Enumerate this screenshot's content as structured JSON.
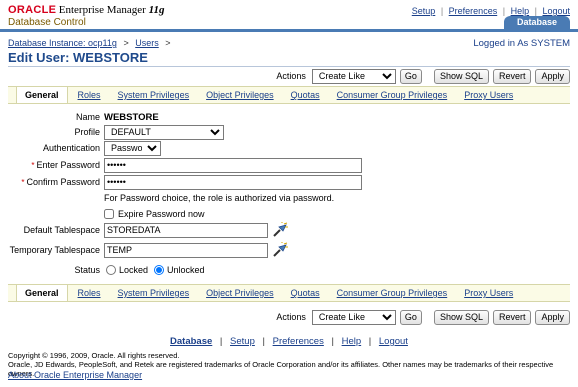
{
  "header": {
    "oracle": "ORACLE",
    "product": "Enterprise Manager",
    "version": "11",
    "version_suffix": "g",
    "subtitle": "Database Control",
    "global_links": [
      "Setup",
      "Preferences",
      "Help",
      "Logout"
    ],
    "database_tab": "Database"
  },
  "breadcrumb": {
    "items": [
      "Database Instance: ocp11g",
      "Users"
    ],
    "separator": ">"
  },
  "logged_in": "Logged in As SYSTEM",
  "page_title": "Edit User: WEBSTORE",
  "actions": {
    "label": "Actions",
    "selected": "Create Like",
    "go": "Go",
    "show_sql": "Show SQL",
    "revert": "Revert",
    "apply": "Apply"
  },
  "tabs": [
    "General",
    "Roles",
    "System Privileges",
    "Object Privileges",
    "Quotas",
    "Consumer Group Privileges",
    "Proxy Users"
  ],
  "active_tab": "General",
  "form": {
    "name_label": "Name",
    "name_value": "WEBSTORE",
    "profile_label": "Profile",
    "profile_value": "DEFAULT",
    "auth_label": "Authentication",
    "auth_value": "Password",
    "required_mark": "*",
    "enter_password_label": "Enter Password",
    "enter_password_value": "••••••",
    "confirm_password_label": "Confirm Password",
    "confirm_password_value": "••••••",
    "password_hint": "For Password choice, the role is authorized via password.",
    "expire_label": "Expire Password now",
    "expire_checked": false,
    "default_ts_label": "Default Tablespace",
    "default_ts_value": "STOREDATA",
    "temp_ts_label": "Temporary Tablespace",
    "temp_ts_value": "TEMP",
    "status_label": "Status",
    "status_options": [
      "Locked",
      "Unlocked"
    ],
    "status_selected": "Unlocked"
  },
  "footer": {
    "links": [
      "Database",
      "Setup",
      "Preferences",
      "Help",
      "Logout"
    ],
    "copyright_line1": "Copyright © 1996, 2009, Oracle. All rights reserved.",
    "copyright_line2": "Oracle, JD Edwards, PeopleSoft, and Retek are registered trademarks of Oracle Corporation and/or its affiliates. Other names may be trademarks of their respective owners.",
    "about": "About Oracle Enterprise Manager"
  },
  "colors": {
    "accent": "#4a7bb4",
    "oracle_red": "#d6001c",
    "link": "#1a3f8a",
    "tab_strip": "#fbfbe6"
  }
}
